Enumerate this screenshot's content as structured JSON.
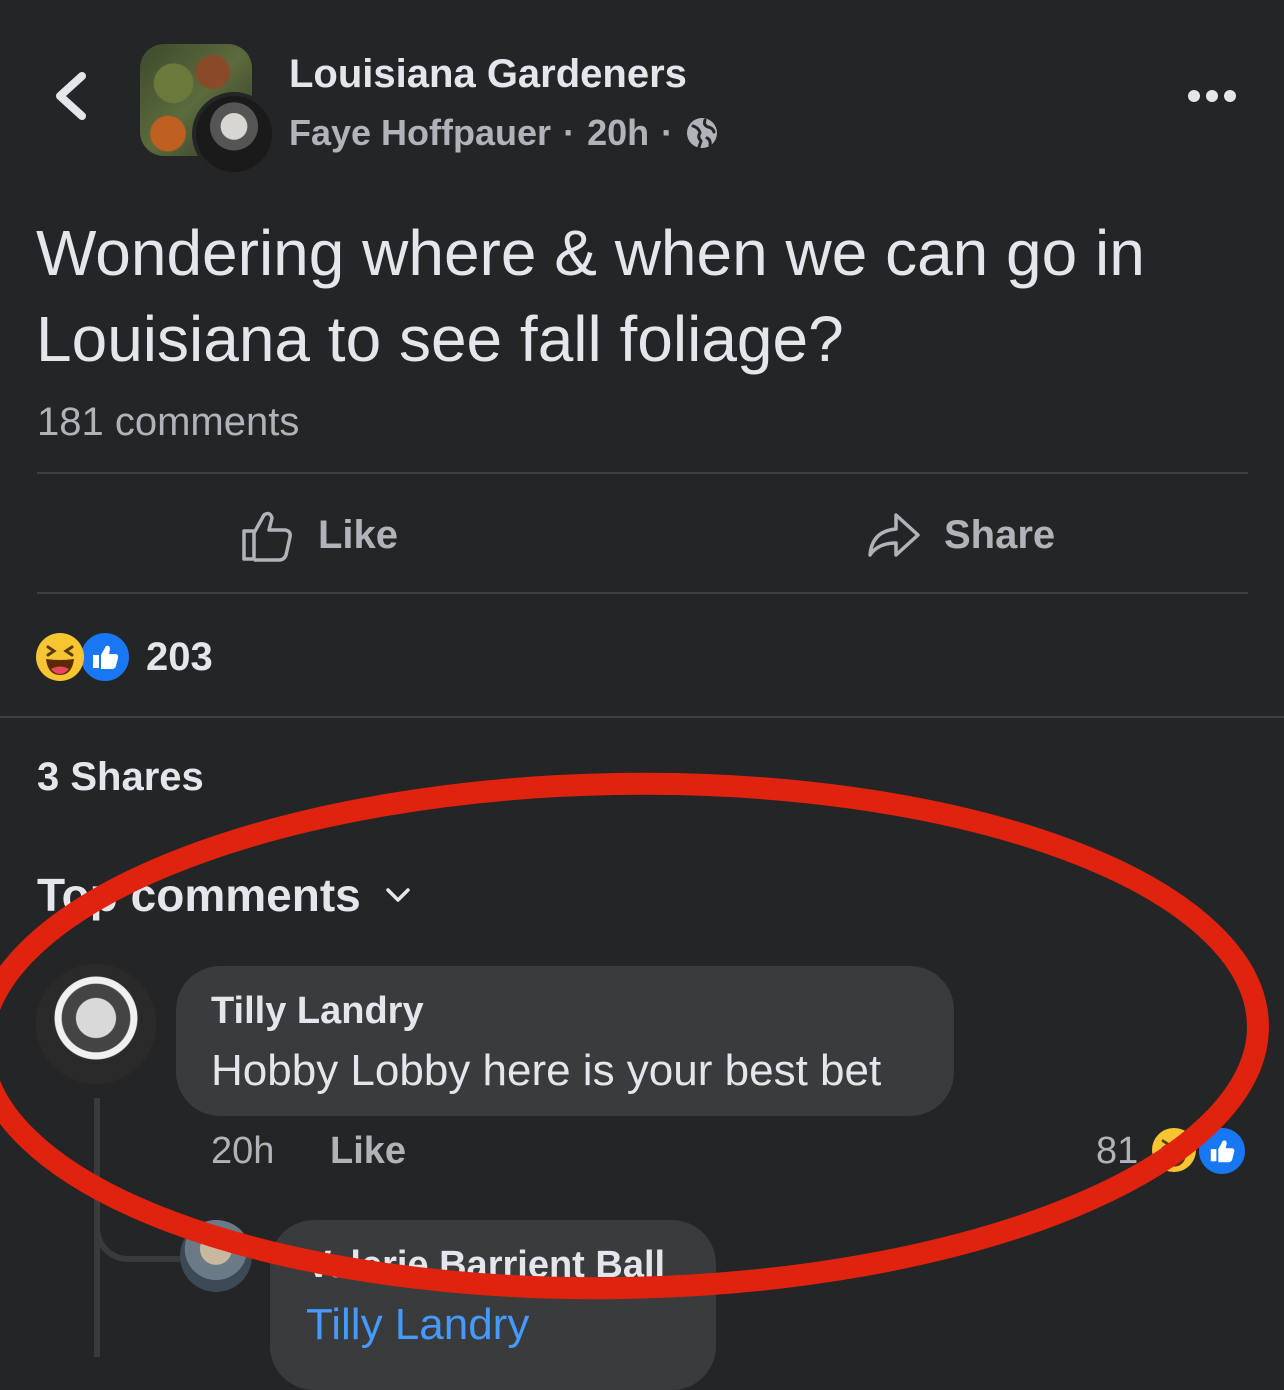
{
  "header": {
    "group_name": "Louisiana Gardeners",
    "author": "Faye Hoffpauer",
    "separator": "·",
    "time": "20h",
    "privacy_icon": "globe-icon"
  },
  "post": {
    "text": "Wondering where & when we can go in Louisiana to see fall foliage?",
    "comments_count": "181 comments"
  },
  "actions": {
    "like_label": "Like",
    "share_label": "Share"
  },
  "reactions": {
    "icons": [
      "haha-icon",
      "like-icon"
    ],
    "count": "203"
  },
  "shares": "3 Shares",
  "comments_section": {
    "title": "Top comments"
  },
  "comments": [
    {
      "name": "Tilly Landry",
      "text": "Hobby Lobby here is your best bet",
      "time": "20h",
      "like_label": "Like",
      "reaction_count": "81",
      "reaction_icons": [
        "haha-icon",
        "like-icon"
      ]
    }
  ],
  "reply": {
    "name": "Valerie Barrient Ball",
    "mention": "Tilly Landry"
  },
  "colors": {
    "background": "#242526",
    "bubble": "#3a3b3c",
    "secondary_text": "#b0b3b8",
    "link": "#4599ff",
    "like_blue": "#1877f2",
    "haha_yellow": "#f7c531",
    "annotation_red": "#e0230e"
  }
}
